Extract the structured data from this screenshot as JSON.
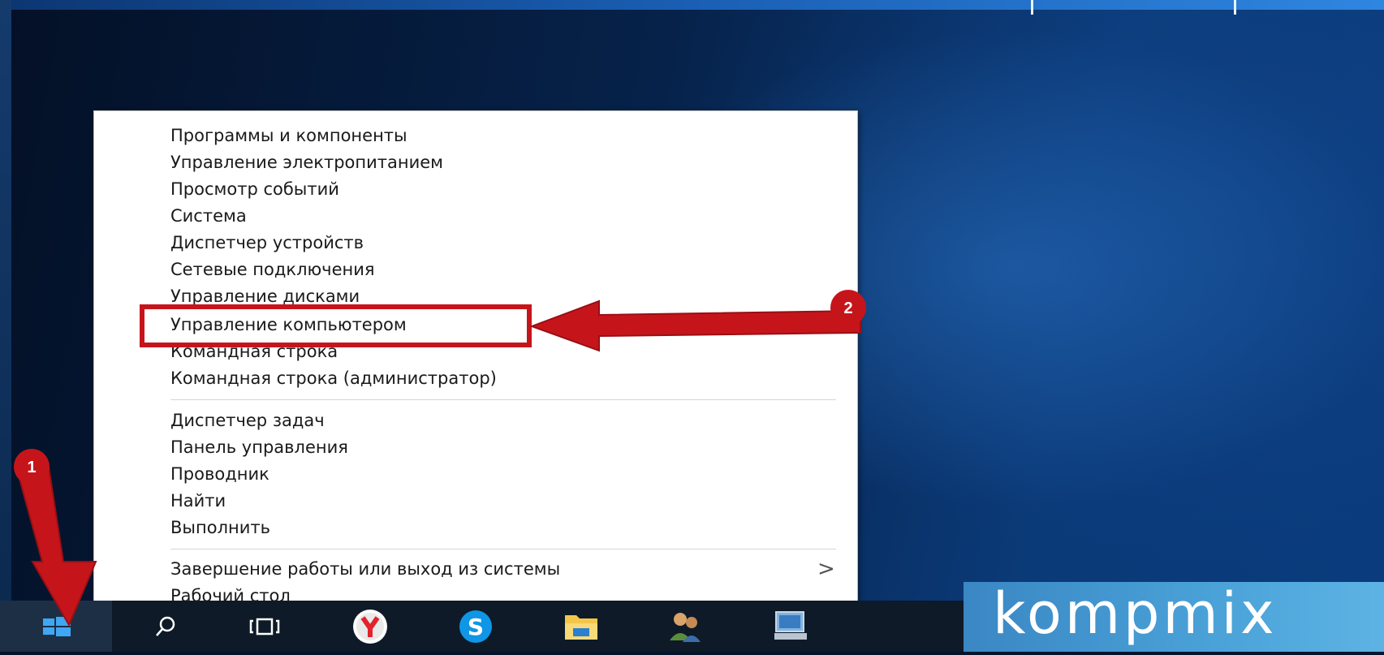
{
  "menu": {
    "items": [
      {
        "label": "Программы и компоненты"
      },
      {
        "label": "Управление электропитанием"
      },
      {
        "label": "Просмотр событий"
      },
      {
        "label": "Система"
      },
      {
        "label": "Диспетчер устройств"
      },
      {
        "label": "Сетевые подключения"
      },
      {
        "label": "Управление дисками"
      },
      {
        "label": "Управление компьютером"
      },
      {
        "label": "Командная строка"
      },
      {
        "label": "Командная строка (администратор)"
      },
      {
        "label": "Диспетчер задач"
      },
      {
        "label": "Панель управления"
      },
      {
        "label": "Проводник"
      },
      {
        "label": "Найти"
      },
      {
        "label": "Выполнить"
      },
      {
        "label": "Завершение работы или выход из системы"
      },
      {
        "label": "Рабочий стол"
      }
    ],
    "highlighted_index": 7,
    "submenu_chevron": ">"
  },
  "annotations": {
    "badge_1": "1",
    "badge_2": "2",
    "color": "#c5151b"
  },
  "taskbar": {
    "icons": [
      "windows-start-icon",
      "search-icon",
      "task-view-icon",
      "yandex-browser-icon",
      "skype-icon",
      "file-explorer-icon",
      "people-icon",
      "computer-icon"
    ]
  },
  "watermark": {
    "text": "kompmix"
  }
}
